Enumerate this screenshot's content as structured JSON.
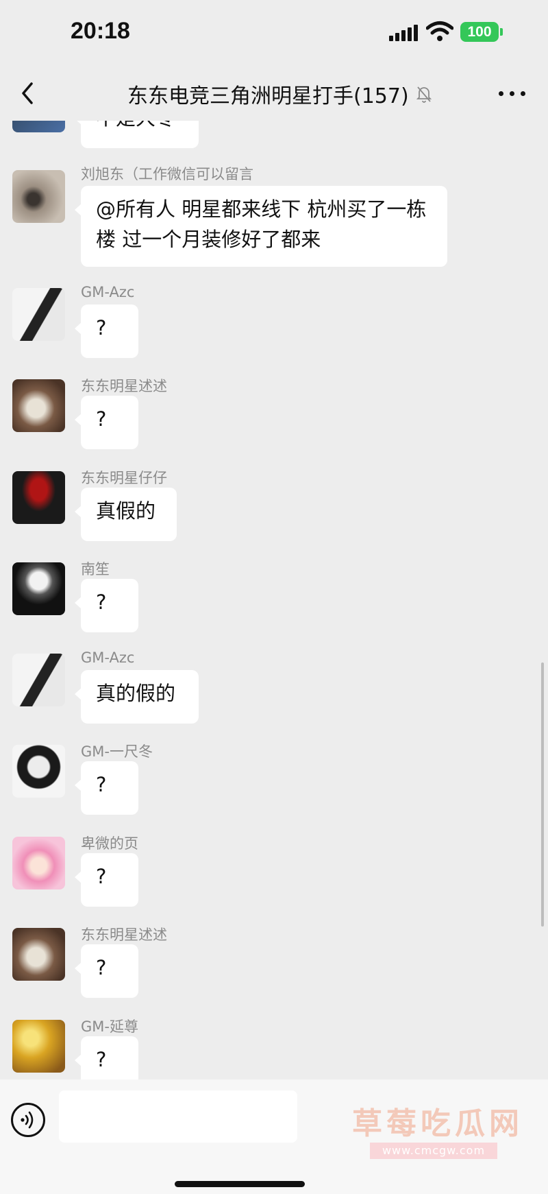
{
  "status_bar": {
    "time": "20:18",
    "battery": "100"
  },
  "header": {
    "title": "东东电竞三角洲明星打手(157)"
  },
  "messages": [
    {
      "sender": "",
      "text": "不是大冬"
    },
    {
      "sender": "刘旭东（工作微信可以留言",
      "text": "@所有人 明星都来线下 杭州买了一栋楼 过一个月装修好了都来"
    },
    {
      "sender": "GM-Azc",
      "text": "?"
    },
    {
      "sender": "东东明星述述",
      "text": "?"
    },
    {
      "sender": "东东明星仔仔",
      "text": "真假的"
    },
    {
      "sender": "南笙",
      "text": "?"
    },
    {
      "sender": "GM-Azc",
      "text": "真的假的"
    },
    {
      "sender": "GM-一尺冬",
      "text": "?"
    },
    {
      "sender": "卑微的页",
      "text": "?"
    },
    {
      "sender": "东东明星述述",
      "text": "?"
    },
    {
      "sender": "GM-延尊",
      "text": "?"
    }
  ],
  "input": {
    "placeholder": ""
  },
  "watermark": {
    "name": "草莓吃瓜网",
    "url": "www.cmcgw.com"
  },
  "colors": {
    "bg": "#ededed",
    "bubble": "#ffffff",
    "battery": "#34c759"
  }
}
